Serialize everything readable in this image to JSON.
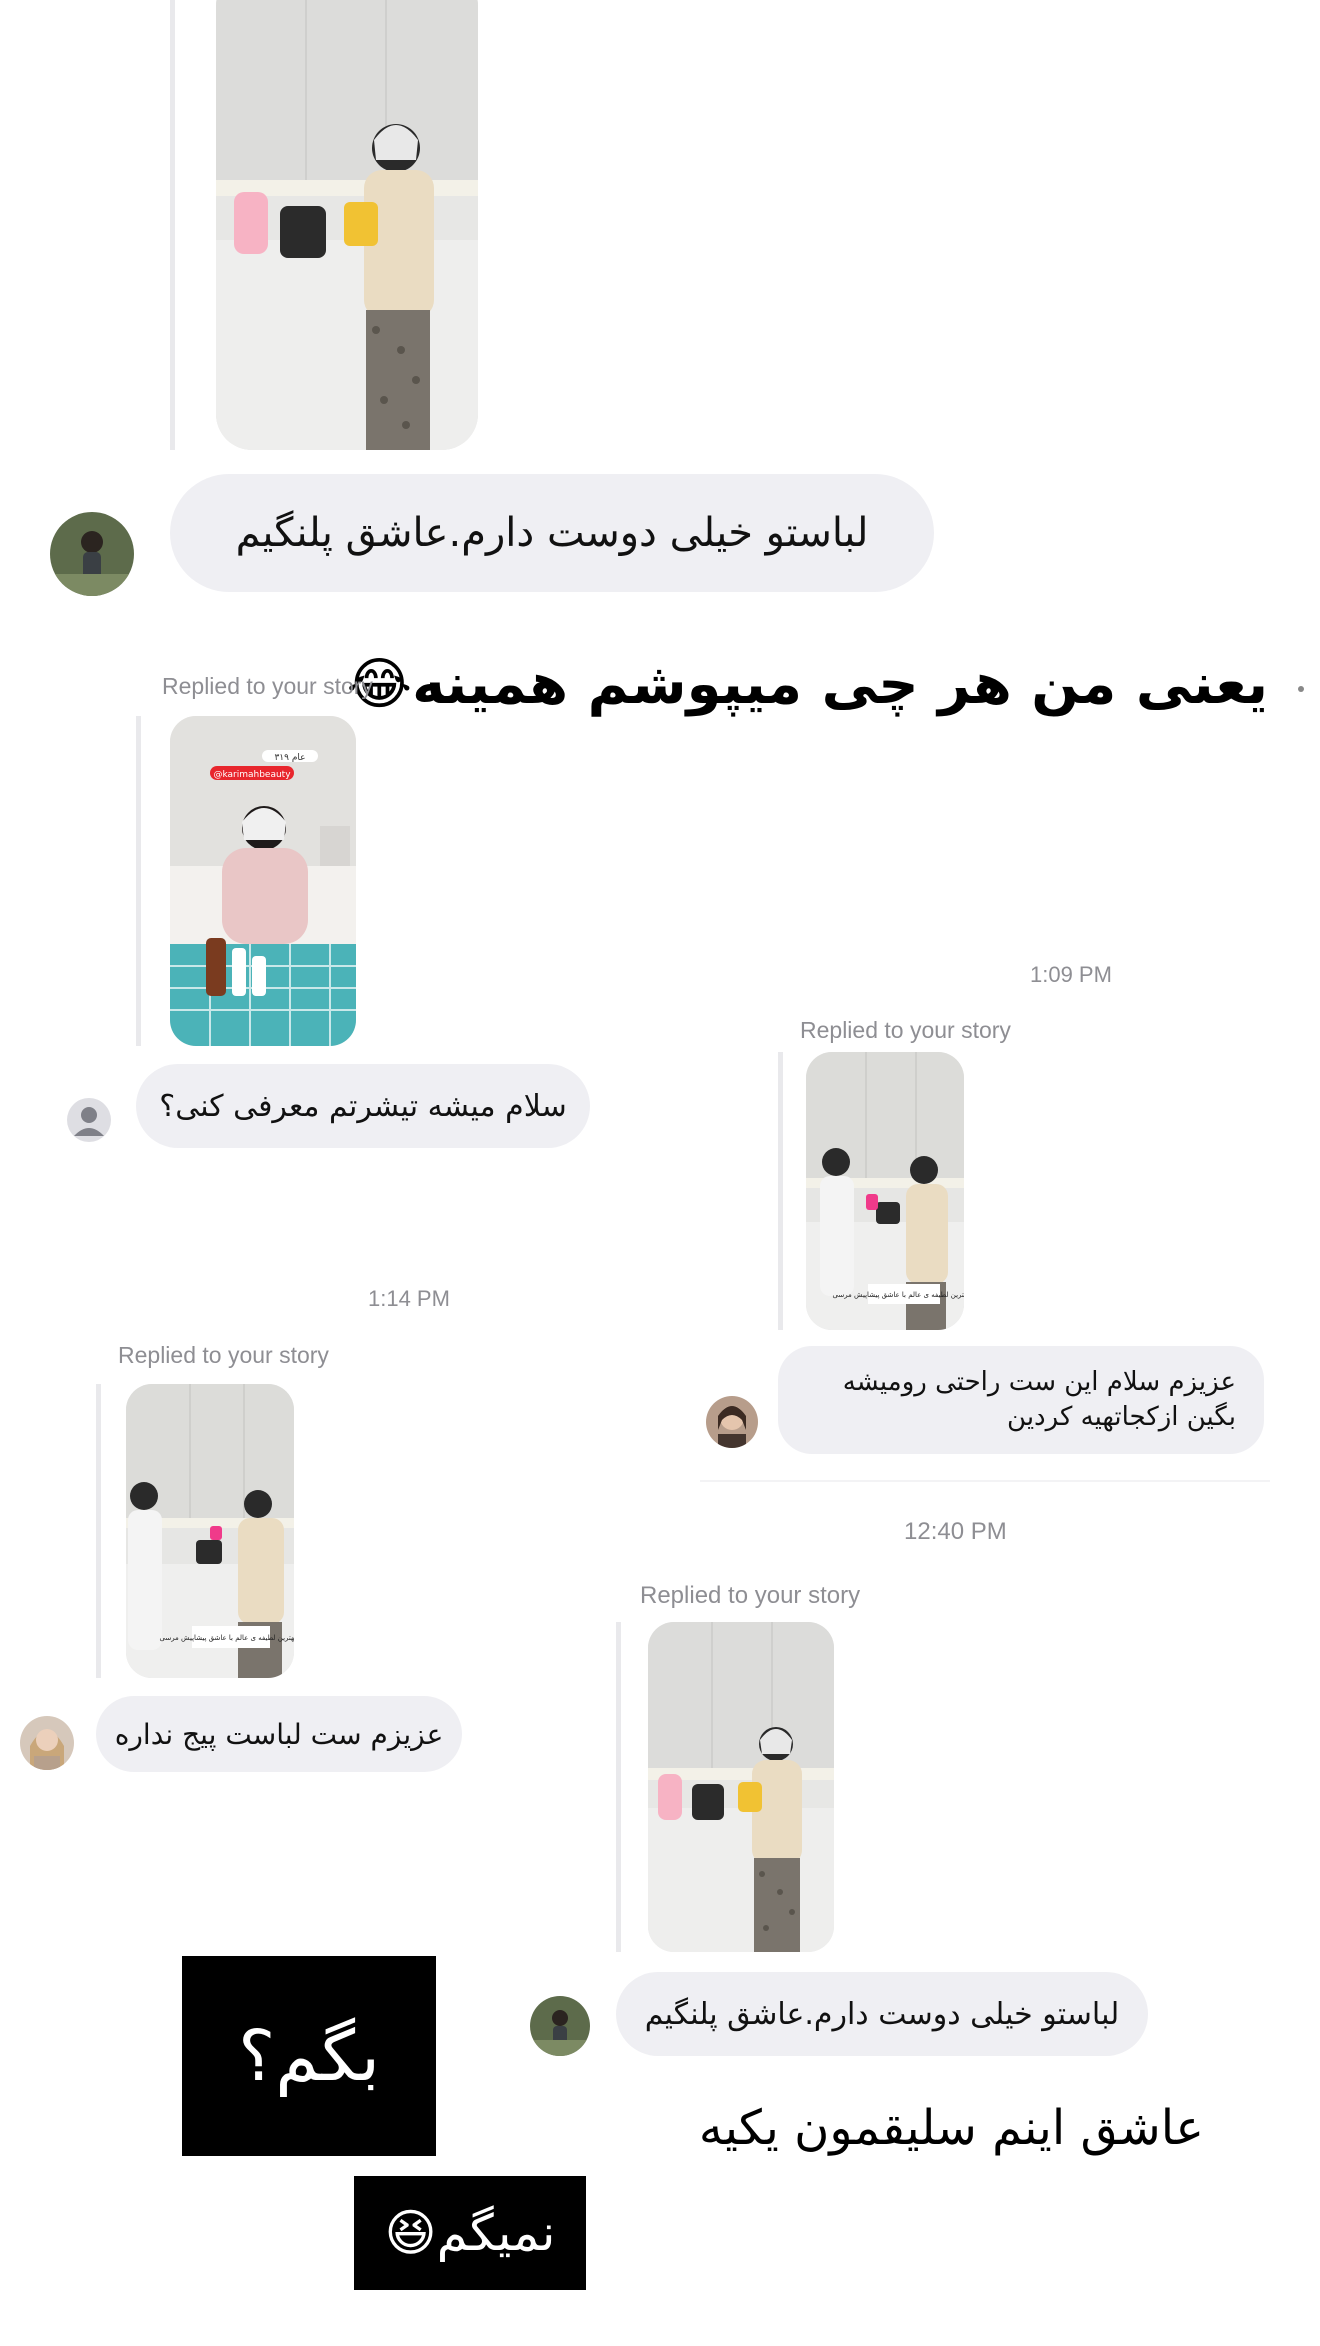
{
  "colors": {
    "bubble_bg": "#efeff3",
    "meta_text": "#8e8e93",
    "thread_line": "#e9e9ec",
    "sticker_bg": "#000000"
  },
  "captions": {
    "top": "یعنی من هر چی میپوشم همینه😂",
    "bottom": "عاشق اینم سلیقمون یکیه"
  },
  "stickers": {
    "ask": "بگم؟",
    "not_telling": "نمیگم😆"
  },
  "messages": [
    {
      "id": "m1",
      "text": "لباستو خیلی دوست دارم.عاشق پلنگیم",
      "avatar": "avatar-woman-full-body"
    },
    {
      "id": "m2",
      "replied_label": "Replied to your story",
      "text": "سلام میشه تیشرتم معرفی کنی؟",
      "avatar": "avatar-placeholder-person"
    },
    {
      "id": "m3",
      "timestamp": "1:09 PM",
      "replied_label": "Replied to your story",
      "text": "عزیزم سلام این ست راحتی رومیشه بگین ازکجاتهیه کردین",
      "avatar": "avatar-woman-portrait"
    },
    {
      "id": "m4",
      "timestamp": "1:14 PM",
      "replied_label": "Replied to your story",
      "text": "عزیزم ست لباست پیج نداره",
      "avatar": "avatar-woman-blonde"
    },
    {
      "id": "m5",
      "timestamp": "12:40 PM",
      "replied_label": "Replied to your story",
      "text": "لباستو خیلی دوست دارم.عاشق پلنگیم",
      "avatar": "avatar-woman-full-body"
    }
  ],
  "story_thumbnails": {
    "pink_outfit": {
      "tag_time": "عام ۳۱۹",
      "tag_handle": "@karimahbeauty"
    },
    "kitchen_caption": "با بهترین لطیفه ی عالم با عاشق پیشاپیش مرسی"
  }
}
